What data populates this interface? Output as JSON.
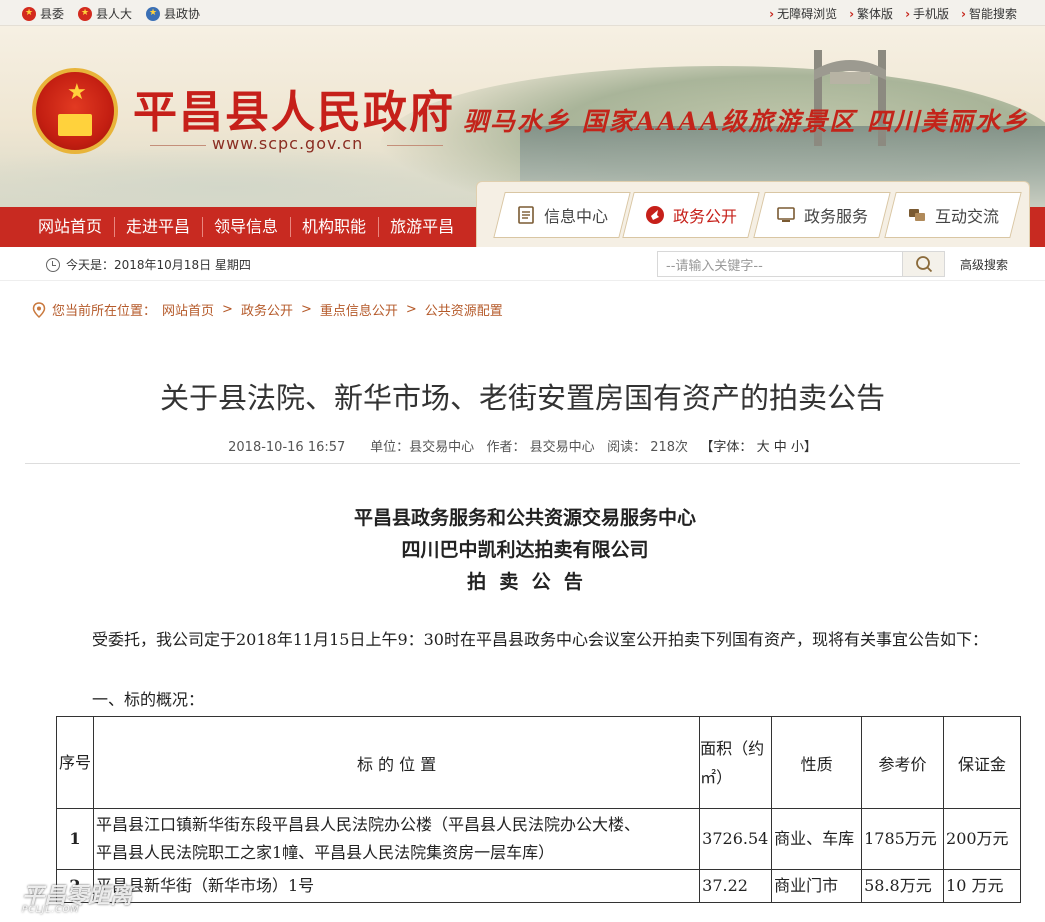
{
  "topbar": {
    "left": [
      "县委",
      "县人大",
      "县政协"
    ],
    "right": [
      "无障碍浏览",
      "繁体版",
      "手机版",
      "智能搜索"
    ]
  },
  "banner": {
    "title": "平昌县人民政府",
    "url": "www.scpc.gov.cn",
    "slogan": "驷马水乡 国家AAAA级旅游景区 四川美丽水乡",
    "bridge_text": "驷马水乡"
  },
  "nav": {
    "items": [
      "网站首页",
      "走进平昌",
      "领导信息",
      "机构职能",
      "旅游平昌"
    ],
    "tabs": [
      "信息中心",
      "政务公开",
      "政务服务",
      "互动交流"
    ],
    "active_tab": "政务公开"
  },
  "info": {
    "date": "今天是：2018年10月18日 星期四",
    "search_placeholder": "--请输入关键字--",
    "advanced": "高级搜索"
  },
  "breadcrumb": {
    "prefix": "您当前所在位置：",
    "items": [
      "网站首页",
      "政务公开",
      "重点信息公开",
      "公共资源配置"
    ]
  },
  "article": {
    "title": "关于县法院、新华市场、老街安置房国有资产的拍卖公告",
    "date": "2018-10-16 16:57",
    "unit": "单位：县交易中心",
    "author": "作者： 县交易中心",
    "views": "阅读： 218次",
    "font_label": "【字体：",
    "font_sizes": "大 中 小",
    "font_close": "】",
    "heading1": "平昌县政务服务和公共资源交易服务中心",
    "heading2": "四川巴中凯利达拍卖有限公司",
    "heading3": "拍  卖  公  告",
    "intro": "受委托，我公司定于2018年11月15日上午9：30时在平昌县政务中心会议室公开拍卖下列国有资产，现将有关事宜公告如下：",
    "section1": "一、标的概况："
  },
  "table": {
    "headers": {
      "no": "序号",
      "location": "标 的 位 置",
      "area": "面积（约㎡）",
      "nature": "性质",
      "ref_price": "参考价",
      "deposit": "保证金"
    },
    "rows": [
      {
        "no": "1",
        "location_line1": "平昌县江口镇新华街东段平昌县人民法院办公楼（平昌县人民法院办公大楼、",
        "location_line2": "平昌县人民法院职工之家1幢、平昌县人民法院集资房一层车库）",
        "area": "3726.54",
        "nature": "商业、车库",
        "ref_price": "1785万元",
        "deposit": "200万元"
      },
      {
        "no": "2",
        "location_line1": "平昌县新华街（新华市场）1号",
        "location_line2": "",
        "area": "37.22",
        "nature": "商业门市",
        "ref_price": "58.8万元",
        "deposit": "10 万元"
      }
    ]
  },
  "watermark": {
    "main": "平昌零距离",
    "sub": "PCLJL.COM"
  },
  "colors": {
    "brand_red": "#c82a21",
    "crumb": "#b55a2a"
  }
}
